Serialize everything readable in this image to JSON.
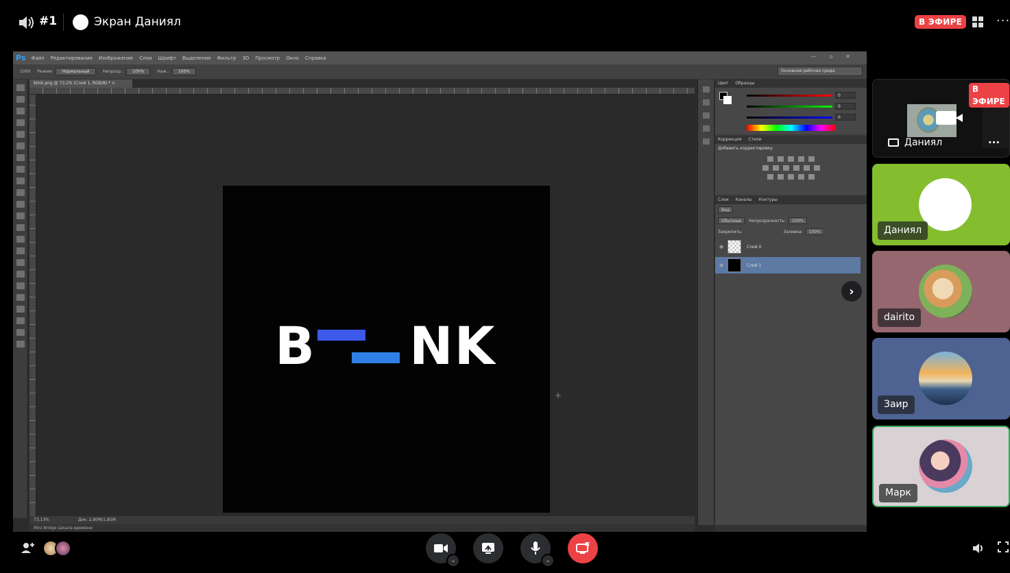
{
  "topbar": {
    "channel": "#1",
    "title": "Экран Даниял",
    "live_badge": "В ЭФИРЕ",
    "more": "···"
  },
  "photoshop": {
    "logo": "Ps",
    "menu": [
      "Файл",
      "Редактирование",
      "Изображение",
      "Слои",
      "Шрифт",
      "Выделение",
      "Фильтр",
      "3D",
      "Просмотр",
      "Окно",
      "Справка"
    ],
    "window_buttons": "— ▫ ✕",
    "options": {
      "brush_size": "1000",
      "mode_label": "Режим:",
      "mode_value": "Нормальный",
      "opacity_label": "Непрозр.:",
      "opacity_value": "100%",
      "flow_label": "Наж.:",
      "flow_value": "100%"
    },
    "workspace": "Основная рабочая среда",
    "doc_tab": "blink.png @ 73,1% (Слой 1, RGB/8) * ×",
    "logo_text_left": "B",
    "logo_text_right": "NK",
    "status_zoom": "73,13%",
    "status_doc": "Док: 2,80M/1,85M",
    "bottom_tabs": "Mini Bridge   Шкала времени",
    "panels": {
      "color_tabs": [
        "Цвет",
        "Образцы"
      ],
      "color_values": [
        "0",
        "0",
        "0"
      ],
      "color_channels": [
        "R",
        "G",
        "B"
      ],
      "adj_tabs": [
        "Коррекция",
        "Стили"
      ],
      "adj_title": "Добавить корректировку",
      "layers_tabs": [
        "Слои",
        "Каналы",
        "Контуры"
      ],
      "kind": "Вид",
      "blend_mode": "Обычные",
      "opacity_label": "Непрозрачность:",
      "opacity_value": "100%",
      "lock_label": "Закрепить:",
      "fill_label": "Заливка:",
      "fill_value": "100%",
      "layers": [
        "Слой 0",
        "Слой 1"
      ]
    }
  },
  "participants": {
    "tile1": {
      "name": "Даниял",
      "badge": "В ЭФИРЕ",
      "more": "···"
    },
    "tile2": {
      "name": "Даниял"
    },
    "tile3": {
      "name": "dairito"
    },
    "tile4": {
      "name": "Заир"
    },
    "tile5": {
      "name": "Марк"
    }
  },
  "colors": {
    "live_red": "#ed4245",
    "tile2_bg": "#84bd2e",
    "tile3_bg": "#96676e",
    "tile4_bg": "#4e6391",
    "tile5_bg": "#d8d2d4",
    "speaking_border": "#3ba55d",
    "logo_blue_1": "#3c59e8",
    "logo_blue_2": "#2f7fe6"
  },
  "icons": {
    "volume": "speaker-icon",
    "grid": "grid-layout-icon",
    "camera": "video-camera-icon",
    "screenshare": "screen-share-icon",
    "mic": "microphone-icon",
    "end": "end-stream-icon",
    "add_user": "add-user-icon",
    "fullscreen": "fullscreen-icon"
  }
}
